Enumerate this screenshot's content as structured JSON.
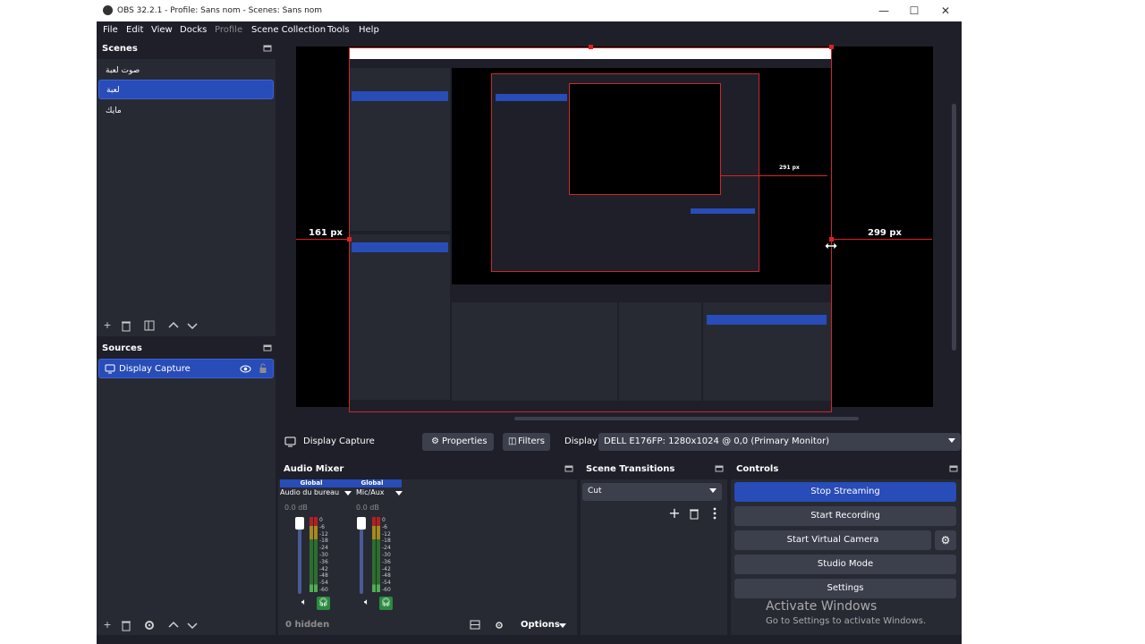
{
  "titlebar": {
    "title": "OBS 32.2.1 - Profile: Sans nom - Scenes: Sans nom",
    "minimize": "—",
    "maximize": "☐",
    "close": "✕"
  },
  "menu": [
    "File",
    "Edit",
    "View",
    "Docks",
    "Profile",
    "Scene Collection",
    "Tools",
    "Help"
  ],
  "scenes": {
    "title": "Scenes",
    "items": [
      "صوت لعبة",
      "لعبة",
      "مايك"
    ],
    "selected_index": 1
  },
  "sources": {
    "title": "Sources",
    "items": [
      "Display Capture"
    ]
  },
  "preview": {
    "left_px": "161 px",
    "right_px": "299 px",
    "inner_px": "291 px"
  },
  "source_toolbar": {
    "source_name": "Display Capture",
    "properties": "Properties",
    "filters": "Filters",
    "display_label": "Display",
    "display_value": "DELL E176FP: 1280x1024 @ 0,0 (Primary Monitor)"
  },
  "audio_mixer": {
    "title": "Audio Mixer",
    "channels": [
      {
        "tag": "Global",
        "name": "Audio du bureau",
        "db": "0.0 dB"
      },
      {
        "tag": "Global",
        "name": "Mic/Aux",
        "db": "0.0 dB"
      }
    ],
    "scale": [
      "0",
      "-6",
      "-12",
      "-18",
      "-24",
      "-30",
      "-36",
      "-42",
      "-48",
      "-54",
      "-60"
    ],
    "hidden_label": "0 hidden",
    "options_label": "Options"
  },
  "scene_transitions": {
    "title": "Scene Transitions",
    "value": "Cut"
  },
  "controls": {
    "title": "Controls",
    "stop_streaming": "Stop Streaming",
    "start_recording": "Start Recording",
    "start_virtual_camera": "Start Virtual Camera",
    "studio_mode": "Studio Mode",
    "settings": "Settings"
  },
  "activate": {
    "title": "Activate Windows",
    "subtitle": "Go to Settings to activate Windows."
  },
  "colors": {
    "accent": "#284cb8",
    "background": "#1e1f29",
    "dock": "#272a33",
    "guide": "#e02020"
  }
}
